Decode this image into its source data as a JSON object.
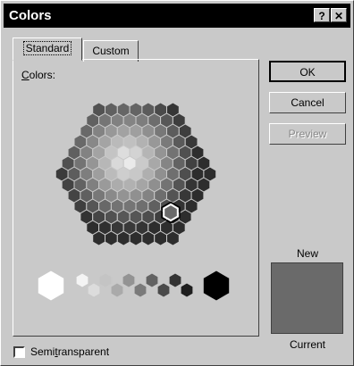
{
  "window": {
    "title": "Colors"
  },
  "titlebar": {
    "help_label": "?",
    "close_label": "✕"
  },
  "tabs": [
    {
      "label": "Standard"
    },
    {
      "label": "Custom"
    }
  ],
  "colors_label": {
    "first": "C",
    "rest": "olors:"
  },
  "buttons": {
    "ok": "OK",
    "cancel": "Cancel",
    "preview": "Preview"
  },
  "preview": {
    "new_label": "New",
    "current_label": "Current",
    "current_color": "#6e6e6e"
  },
  "semitransparent": {
    "label_pre": "Semi",
    "label_accel": "t",
    "label_post": "ransparent",
    "checked": false
  },
  "selected_color": "#6a6a6a"
}
